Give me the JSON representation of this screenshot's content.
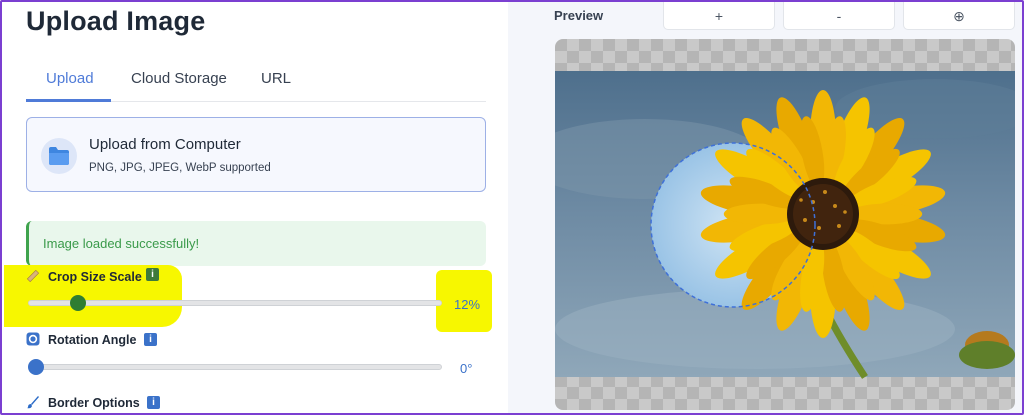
{
  "header": {
    "title": "Upload Image"
  },
  "tabs": [
    {
      "label": "Upload"
    },
    {
      "label": "Cloud Storage"
    },
    {
      "label": "URL"
    }
  ],
  "upload": {
    "title": "Upload from Computer",
    "formats": "PNG, JPG, JPEG, WebP supported",
    "icon": "folder-icon"
  },
  "status": {
    "message": "Image loaded successfully!",
    "color": "#3a9a4a"
  },
  "controls": {
    "crop": {
      "label": "Crop Size Scale",
      "value_text": "12%",
      "value": 0.12,
      "thumb_color": "#2f7d32",
      "icon": "ruler-icon"
    },
    "rotation": {
      "label": "Rotation Angle",
      "value_text": "0°",
      "value": 0,
      "thumb_color": "#3b72c9",
      "icon": "rotate-icon"
    },
    "border": {
      "label": "Border Options",
      "icon": "brush-icon"
    },
    "info_glyph": "i"
  },
  "preview": {
    "label": "Preview",
    "zoom_in": "+",
    "zoom_out": "-",
    "center": "⊕"
  },
  "colors": {
    "accent": "#4f7bd8",
    "highlight": "#f7f700",
    "success_bg": "#e9f7ec"
  }
}
